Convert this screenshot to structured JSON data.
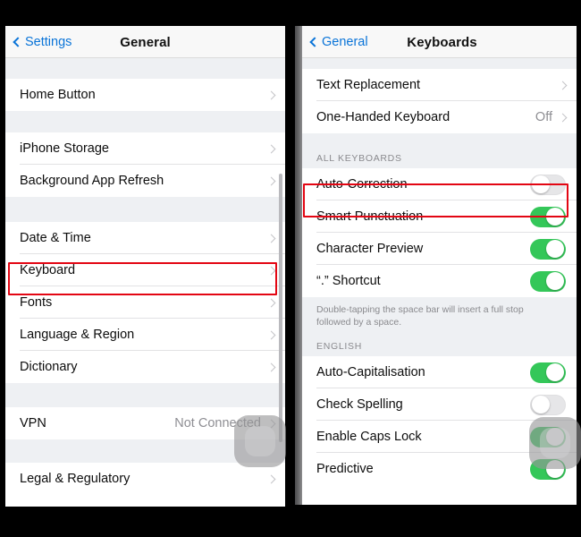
{
  "accent_colors": {
    "link_blue": "#0a74d8",
    "toggle_on_green": "#34c759",
    "toggle_off_grey": "#e6e6e8",
    "highlight_red": "#e30613",
    "group_background": "#eef0f3"
  },
  "left_screen": {
    "navbar": {
      "back_label": "Settings",
      "title": "General",
      "back_icon": "chevron-left-icon"
    },
    "groups": [
      {
        "rows": [
          {
            "label": "Home Button",
            "accessory": "chevron-right-icon"
          }
        ]
      },
      {
        "rows": [
          {
            "label": "iPhone Storage",
            "accessory": "chevron-right-icon"
          },
          {
            "label": "Background App Refresh",
            "accessory": "chevron-right-icon"
          }
        ]
      },
      {
        "rows": [
          {
            "label": "Date & Time",
            "accessory": "chevron-right-icon"
          },
          {
            "label": "Keyboard",
            "accessory": "chevron-right-icon",
            "highlighted": true
          },
          {
            "label": "Fonts",
            "accessory": "chevron-right-icon"
          },
          {
            "label": "Language & Region",
            "accessory": "chevron-right-icon"
          },
          {
            "label": "Dictionary",
            "accessory": "chevron-right-icon"
          }
        ]
      },
      {
        "rows": [
          {
            "label": "VPN",
            "value": "Not Connected",
            "accessory": "chevron-right-icon"
          }
        ]
      },
      {
        "rows": [
          {
            "label": "Legal & Regulatory",
            "accessory": "chevron-right-icon"
          }
        ]
      }
    ]
  },
  "right_screen": {
    "navbar": {
      "back_label": "General",
      "title": "Keyboards",
      "back_icon": "chevron-left-icon"
    },
    "group_top": {
      "rows": [
        {
          "label": "Text Replacement",
          "accessory": "chevron-right-icon"
        },
        {
          "label": "One-Handed Keyboard",
          "value": "Off",
          "accessory": "chevron-right-icon"
        }
      ]
    },
    "section_all_keyboards": {
      "header": "ALL KEYBOARDS",
      "rows": [
        {
          "label": "Auto-Correction",
          "toggle": "off",
          "highlighted": true
        },
        {
          "label": "Smart Punctuation",
          "toggle": "on"
        },
        {
          "label": "Character Preview",
          "toggle": "on"
        },
        {
          "label": "“.” Shortcut",
          "toggle": "on"
        }
      ],
      "footer": "Double-tapping the space bar will insert a full stop followed by a space."
    },
    "section_english": {
      "header": "ENGLISH",
      "rows": [
        {
          "label": "Auto-Capitalisation",
          "toggle": "on"
        },
        {
          "label": "Check Spelling",
          "toggle": "off"
        },
        {
          "label": "Enable Caps Lock",
          "toggle": "on"
        },
        {
          "label": "Predictive",
          "toggle": "on"
        }
      ]
    }
  }
}
